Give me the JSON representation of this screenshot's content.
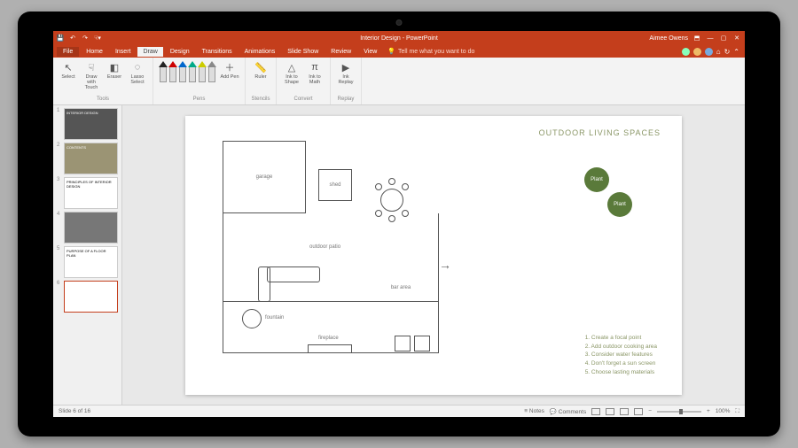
{
  "titlebar": {
    "title": "Interior Design - PowerPoint",
    "user": "Aimee Owens"
  },
  "menu": {
    "file": "File",
    "tabs": [
      "Home",
      "Insert",
      "Draw",
      "Design",
      "Transitions",
      "Animations",
      "Slide Show",
      "Review",
      "View"
    ],
    "active_tab": "Draw",
    "tell_me": "Tell me what you want to do"
  },
  "ribbon": {
    "tools": {
      "label": "Tools",
      "select": "Select",
      "draw_touch": "Draw with Touch",
      "eraser": "Eraser",
      "lasso": "Lasso Select"
    },
    "pens": {
      "label": "Pens",
      "add_pen": "Add Pen",
      "colors": [
        "#222",
        "#c00",
        "#06c",
        "#0a8",
        "#cc0",
        "#888"
      ]
    },
    "stencils": {
      "label": "Stencils",
      "ruler": "Ruler"
    },
    "convert": {
      "label": "Convert",
      "ink_shape": "Ink to Shape",
      "ink_math": "Ink to Math"
    },
    "replay": {
      "label": "Replay",
      "ink_replay": "Ink Replay"
    }
  },
  "thumbnails": [
    {
      "n": "1",
      "title": "INTERIOR DESIGN"
    },
    {
      "n": "2",
      "title": "CONTENTS"
    },
    {
      "n": "3",
      "title": "PRINCIPLES OF INTERIOR DESIGN"
    },
    {
      "n": "4",
      "title": ""
    },
    {
      "n": "5",
      "title": "PURPOSE OF A FLOOR PLAN"
    },
    {
      "n": "6",
      "title": ""
    }
  ],
  "slide": {
    "title": "OUTDOOR LIVING SPACES",
    "rooms": {
      "garage": "garage",
      "shed": "shed",
      "patio": "outdoor patio",
      "bar": "bar area",
      "fountain": "fountain",
      "fireplace": "fireplace"
    },
    "plants": [
      "Plant",
      "Plant"
    ],
    "tips": [
      "1. Create a focal point",
      "2. Add outdoor cooking area",
      "3. Consider water features",
      "4. Don't forget a sun screen",
      "5. Choose lasting materials"
    ]
  },
  "status": {
    "slide_info": "Slide 6 of 16",
    "notes": "Notes",
    "comments": "Comments",
    "zoom": "100%"
  }
}
